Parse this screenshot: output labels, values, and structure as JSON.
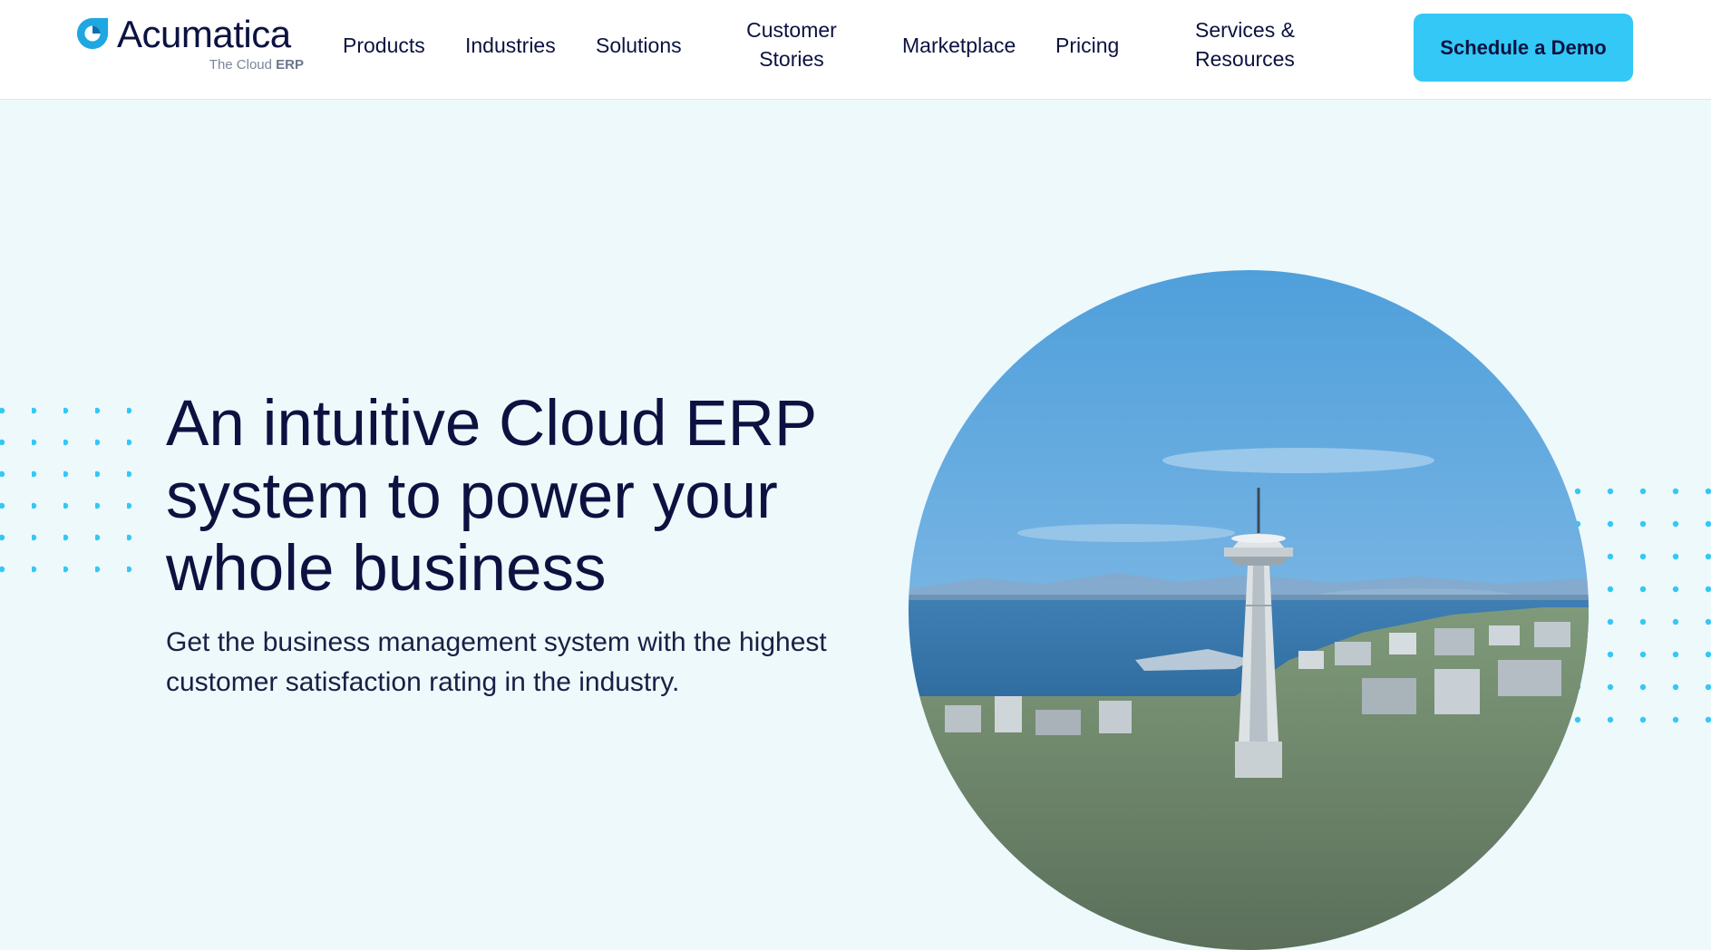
{
  "brand": {
    "name": "Acumatica",
    "tagline_prefix": "The Cloud ",
    "tagline_bold": "ERP",
    "accent_color": "#33c8f6",
    "dark_color": "#0c1240",
    "logo_icon": "acumatica-logo-icon"
  },
  "nav": {
    "products": "Products",
    "industries": "Industries",
    "solutions": "Solutions",
    "customer_stories_1": "Customer",
    "customer_stories_2": "Stories",
    "marketplace": "Marketplace",
    "pricing": "Pricing",
    "services_1": "Services &",
    "services_2": "Resources"
  },
  "cta": {
    "label": "Schedule a Demo"
  },
  "hero": {
    "title_line1": "An intuitive Cloud ERP",
    "title_line2": "system to power your",
    "title_line3": "whole business",
    "subtitle_line1": "Get the business management system with the highest",
    "subtitle_line2": "customer satisfaction rating in the industry.",
    "image_subject": "space-needle-seattle-skyline"
  }
}
